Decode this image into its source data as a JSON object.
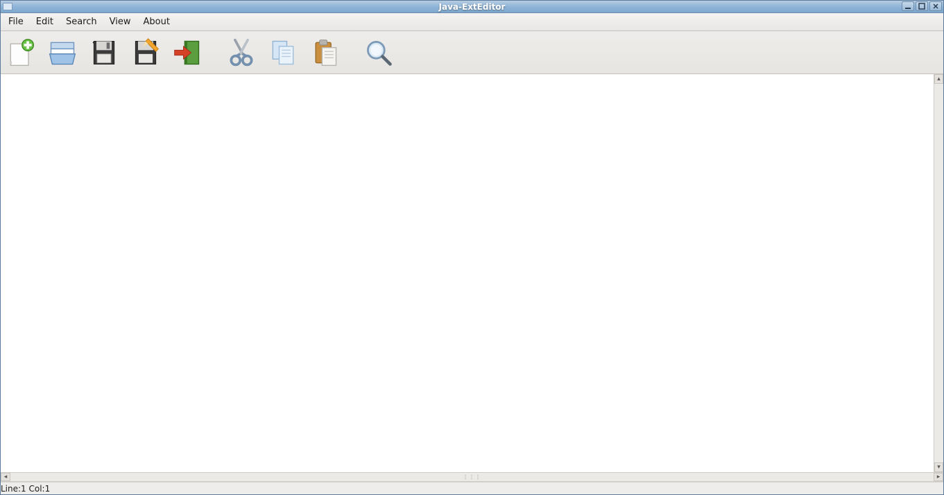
{
  "window": {
    "title": "Java-ExtEditor"
  },
  "menu": {
    "items": [
      "File",
      "Edit",
      "Search",
      "View",
      "About"
    ]
  },
  "toolbar": {
    "icons": [
      "new",
      "open",
      "save",
      "save-as",
      "close",
      "cut",
      "copy",
      "paste",
      "find"
    ]
  },
  "editor": {
    "content": ""
  },
  "status": {
    "position": "Line:1 Col:1"
  }
}
